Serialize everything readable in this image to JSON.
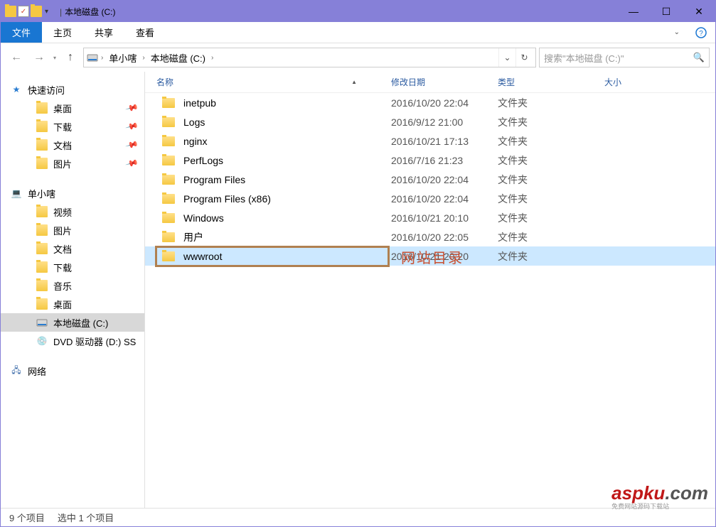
{
  "window": {
    "title": "本地磁盘 (C:)"
  },
  "ribbon": {
    "file": "文件",
    "tabs": [
      "主页",
      "共享",
      "查看"
    ]
  },
  "nav": {
    "crumbs": [
      "单小嗐",
      "本地磁盘 (C:)"
    ],
    "search_placeholder": "搜索\"本地磁盘 (C:)\""
  },
  "sidebar": {
    "quick": {
      "label": "快速访问",
      "items": [
        "桌面",
        "下载",
        "文档",
        "图片"
      ]
    },
    "pc": {
      "label": "单小嗐",
      "items": [
        "视频",
        "图片",
        "文档",
        "下载",
        "音乐",
        "桌面",
        "本地磁盘 (C:)",
        "DVD 驱动器 (D:) SS"
      ],
      "selected_index": 6
    },
    "network": "网络"
  },
  "columns": {
    "name": "名称",
    "date": "修改日期",
    "type": "类型",
    "size": "大小"
  },
  "files": [
    {
      "name": "inetpub",
      "date": "2016/10/20 22:04",
      "type": "文件夹"
    },
    {
      "name": "Logs",
      "date": "2016/9/12 21:00",
      "type": "文件夹"
    },
    {
      "name": "nginx",
      "date": "2016/10/21 17:13",
      "type": "文件夹"
    },
    {
      "name": "PerfLogs",
      "date": "2016/7/16 21:23",
      "type": "文件夹"
    },
    {
      "name": "Program Files",
      "date": "2016/10/20 22:04",
      "type": "文件夹"
    },
    {
      "name": "Program Files (x86)",
      "date": "2016/10/20 22:04",
      "type": "文件夹"
    },
    {
      "name": "Windows",
      "date": "2016/10/21 20:10",
      "type": "文件夹"
    },
    {
      "name": "用户",
      "date": "2016/10/20 22:05",
      "type": "文件夹"
    },
    {
      "name": "wwwroot",
      "date": "2016/10/21 20:20",
      "type": "文件夹",
      "selected": true
    }
  ],
  "annotation": "网站目录",
  "status": {
    "count": "9 个项目",
    "selected": "选中 1 个项目"
  },
  "watermark": {
    "main": "aspku",
    "suffix": ".com",
    "sub": "免费网站源码下载站"
  }
}
